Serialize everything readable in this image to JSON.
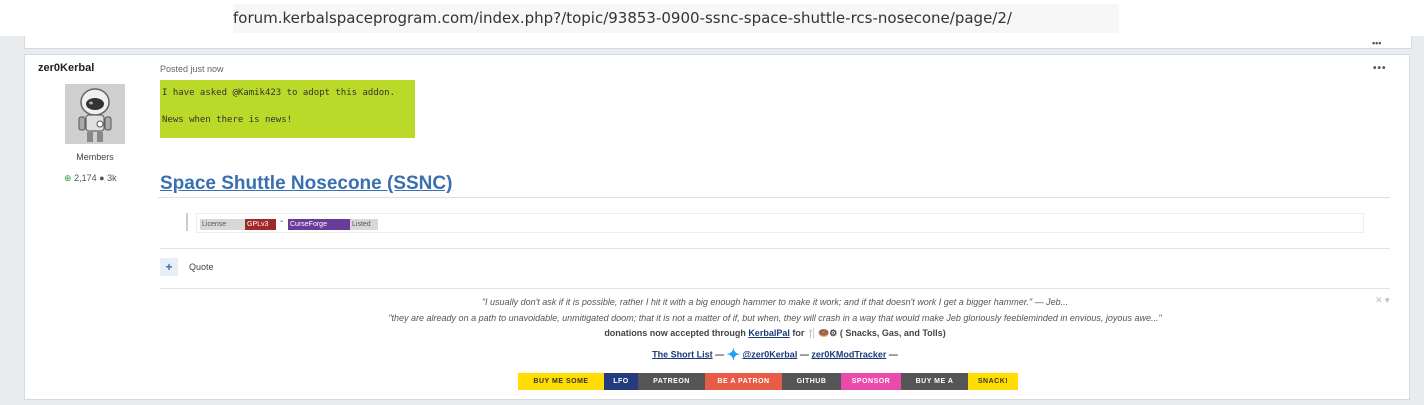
{
  "browser": {
    "url": "forum.kerbalspaceprogram.com/index.php?/topic/93853-0900-ssnc-space-shuttle-rcs-nosecone/page/2/"
  },
  "previous_post": {
    "more_label": "•••"
  },
  "post": {
    "author": "zer0Kerbal",
    "group": "Members",
    "reputation": "2,174",
    "posts": "3k",
    "posted": "Posted just now",
    "more_label": "•••",
    "notice_line1": "I have asked   @Kamik423   to adopt this addon.",
    "notice_line2": "News when there is news!",
    "notice_color": "#bbd928",
    "title": "Space Shuttle Nosecone (SSNC)",
    "badges": {
      "license_label": "License",
      "license_value": "GPLv3",
      "separator": "-",
      "curseforge_label": "CurseForge",
      "curseforge_value": "Listed"
    },
    "quote_plus": "+",
    "quote_label": "Quote"
  },
  "signature": {
    "close": "✕ ▾",
    "line1": "\"I usually don't ask if it is possible, rather I hit it with a big enough hammer to make it work; and if that doesn't work I get a bigger hammer.\"  — Jeb...",
    "line2": "\"they are already on a path to unavoidable, unmitigated doom; that it is not a matter of if, but when, they will crash in a way that would make Jeb gloriously feebleminded in envious, joyous awe...\"",
    "line3_prefix": "donations now accepted through ",
    "line3_link": "KerbalPal",
    "line3_suffix": " for  🍴🍩⚙ ( Snacks, Gas, and Tolls)",
    "shortlist": "The Short List",
    "dash1": " — ",
    "twitter": "@zer0Kerbal",
    "dash2": " — ",
    "modtracker": "zer0KModTracker",
    "dash3": " —",
    "buttons": [
      {
        "label": "BUY ME SOME",
        "bg": "#ffdd00",
        "fg": "#333333"
      },
      {
        "label": "LFO",
        "bg": "#253b80",
        "fg": "#ffffff"
      },
      {
        "label": "PATREON",
        "bg": "#555555",
        "fg": "#ffffff"
      },
      {
        "label": "BE A PATRON",
        "bg": "#e85b46",
        "fg": "#ffffff"
      },
      {
        "label": "GITHUB",
        "bg": "#555555",
        "fg": "#ffffff"
      },
      {
        "label": "SPONSOR",
        "bg": "#ea4aaa",
        "fg": "#ffffff"
      },
      {
        "label": "BUY ME A",
        "bg": "#555555",
        "fg": "#ffffff"
      },
      {
        "label": "SNACK!",
        "bg": "#ffdd00",
        "fg": "#333333"
      }
    ]
  }
}
